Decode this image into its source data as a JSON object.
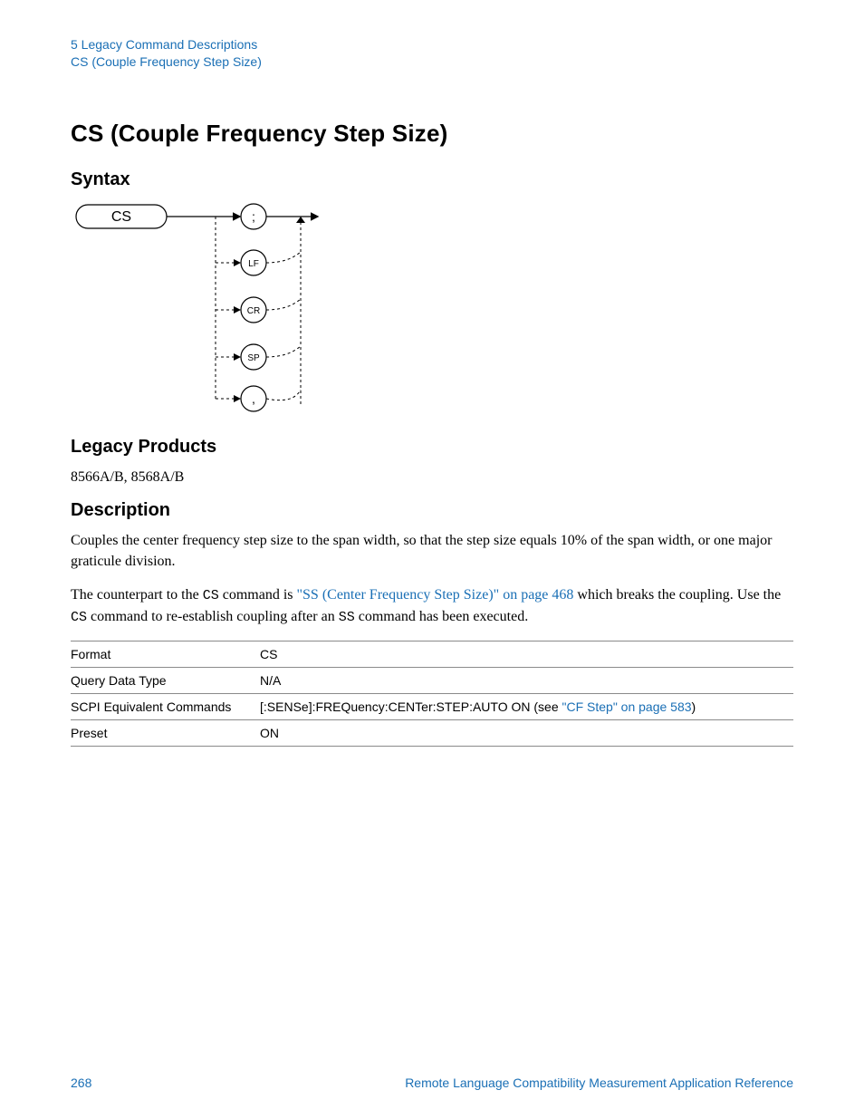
{
  "breadcrumb": {
    "chapter": "5  Legacy Command Descriptions",
    "topic": "CS (Couple Frequency Step Size)"
  },
  "title": "CS (Couple Frequency Step Size)",
  "sections": {
    "syntax": "Syntax",
    "legacy": "Legacy Products",
    "description": "Description"
  },
  "diagram": {
    "start": "CS",
    "options": [
      ";",
      "LF",
      "CR",
      "SP",
      ","
    ]
  },
  "legacy_products": "8566A/B, 8568A/B",
  "desc_para1": "Couples the center frequency step size to the span width, so that the step size equals 10% of the span width, or one major graticule division.",
  "desc_para2_pre": "The counterpart to the ",
  "desc_para2_code1": "CS",
  "desc_para2_mid1": " command is ",
  "desc_para2_link": "\"SS (Center Frequency Step Size)\" on page 468",
  "desc_para2_mid2": " which breaks the coupling. Use the ",
  "desc_para2_code2": "CS",
  "desc_para2_mid3": " command to re-establish coupling after an ",
  "desc_para2_code3": "SS",
  "desc_para2_end": " command has been executed.",
  "table": {
    "rows": [
      {
        "label": "Format",
        "value_plain": "CS"
      },
      {
        "label": "Query Data Type",
        "value_plain": "N/A"
      },
      {
        "label": "SCPI Equivalent Commands",
        "value_pre": "[:SENSe]:FREQuency:CENTer:STEP:AUTO ON (see ",
        "value_link": "\"CF Step\" on page 583",
        "value_post": ")"
      },
      {
        "label": "Preset",
        "value_plain": "ON"
      }
    ]
  },
  "footer": {
    "page": "268",
    "doc": "Remote Language Compatibility Measurement Application Reference"
  }
}
